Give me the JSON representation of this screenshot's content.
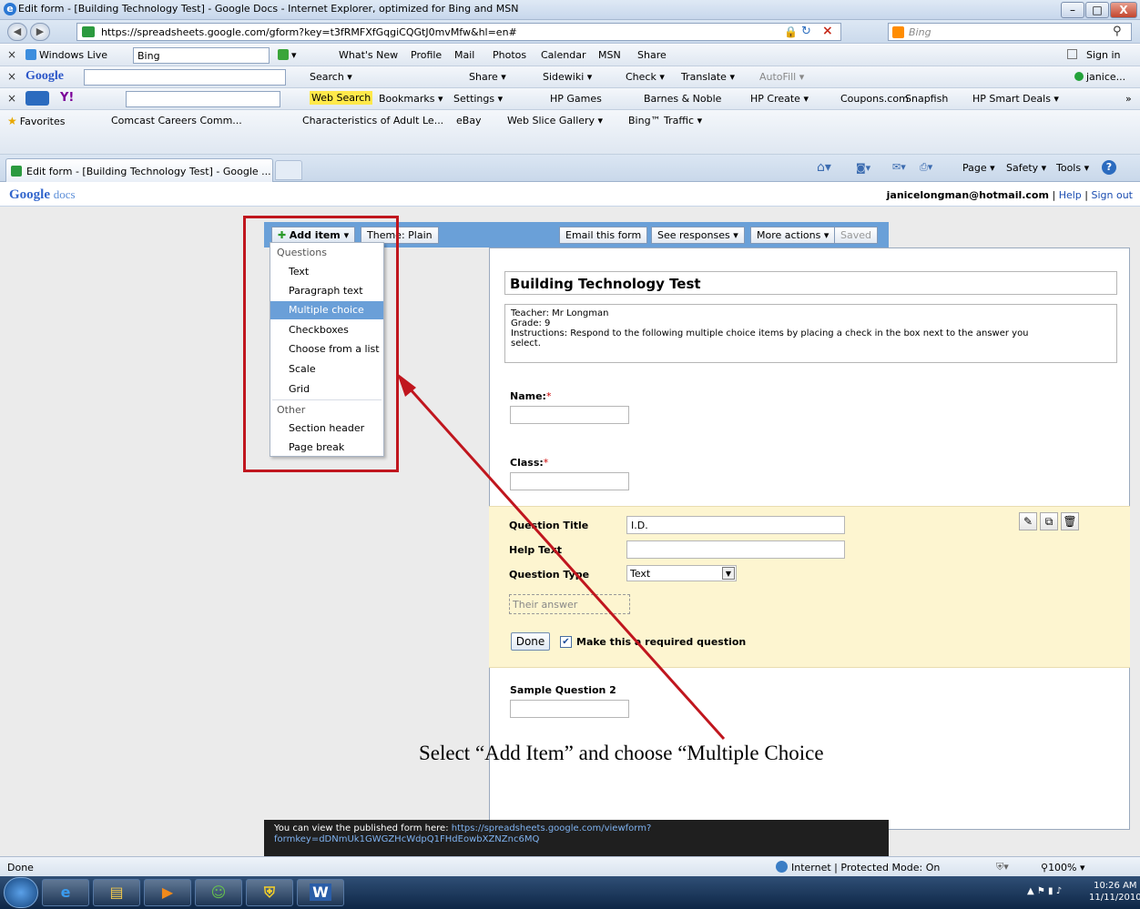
{
  "window": {
    "title": "Edit form - [Building Technology Test] - Google Docs - Internet Explorer, optimized for Bing and MSN",
    "min_label": "–",
    "max_label": "□",
    "close_label": "X"
  },
  "address": {
    "url": "https://spreadsheets.google.com/gform?key=t3fRMFXfGqgiCQGtJ0mvMfw&hl=en#",
    "search_placeholder": "Bing"
  },
  "toolbar1": {
    "brand": "Windows Live",
    "search_value": "Bing",
    "links": [
      "What's New",
      "Profile",
      "Mail",
      "Photos",
      "Calendar",
      "MSN",
      "Share"
    ],
    "sign_in": "Sign in"
  },
  "toolbar2": {
    "brand": "Google",
    "items": [
      "Search ▾",
      "Share ▾",
      "Sidewiki ▾",
      "Check ▾",
      "Translate ▾",
      "AutoFill ▾"
    ],
    "user": "janice..."
  },
  "toolbar3": {
    "items": [
      "Web Search",
      "Bookmarks ▾",
      "Settings ▾",
      "HP Games",
      "Barnes & Noble",
      "HP Create ▾",
      "Coupons.com",
      "Snapfish",
      "HP Smart Deals ▾"
    ]
  },
  "favorites": {
    "label": "Favorites",
    "items": [
      "Comcast Careers Comm...",
      "Characteristics of Adult Le...",
      "eBay",
      "Web Slice Gallery ▾",
      "Bing™ Traffic ▾"
    ]
  },
  "tabs": {
    "active_label": "Edit form - [Building Technology Test] - Google ...",
    "commands": [
      "Page ▾",
      "Safety ▾",
      "Tools ▾"
    ]
  },
  "docs": {
    "logo_google": "Google",
    "logo_docs": "docs",
    "account_email": "janicelongman@hotmail.com",
    "separator": "|",
    "help": "Help",
    "sign_out": "Sign out"
  },
  "form_toolbar": {
    "add_item": "Add item ▾",
    "theme": "Theme: Plain",
    "email_form": "Email this form",
    "see_responses": "See responses ▾",
    "more_actions": "More actions ▾",
    "saved": "Saved"
  },
  "dropdown": {
    "questions_header": "Questions",
    "questions": [
      "Text",
      "Paragraph text",
      "Multiple choice",
      "Checkboxes",
      "Choose from a list",
      "Scale",
      "Grid"
    ],
    "selected_index": 2,
    "other_header": "Other",
    "other": [
      "Section header",
      "Page break"
    ]
  },
  "form": {
    "title": "Building Technology Test",
    "description_lines": [
      "Teacher: Mr Longman",
      "Grade: 9",
      "Instructions: Respond to the following multiple choice items by placing a check in the box next to the answer you",
      "select."
    ],
    "name_label": "Name:",
    "class_label": "Class:",
    "required_mark": "*",
    "edit": {
      "question_title_label": "Question Title",
      "question_title_value": "I.D.",
      "help_text_label": "Help Text",
      "question_type_label": "Question Type",
      "question_type_value": "Text",
      "answer_placeholder": "Their answer",
      "done": "Done",
      "required_label": "Make this a required question",
      "required_checked": true
    },
    "sample_question": "Sample Question 2"
  },
  "annotation": {
    "instruction": "Select “Add Item” and choose “Multiple Choice",
    "color": "#c0161e"
  },
  "notice": {
    "line1_text": "You can view the published form here: ",
    "line1_link": "https://spreadsheets.google.com/viewform?",
    "line2_link": "formkey=dDNmUk1GWGZHcWdpQ1FHdEowbXZNZnc6MQ"
  },
  "statusbar": {
    "status": "Done",
    "zone": "Internet | Protected Mode: On",
    "zoom": "100%"
  },
  "taskbar": {
    "time": "10:26 AM",
    "date": "11/11/2010",
    "word_label": "W"
  }
}
